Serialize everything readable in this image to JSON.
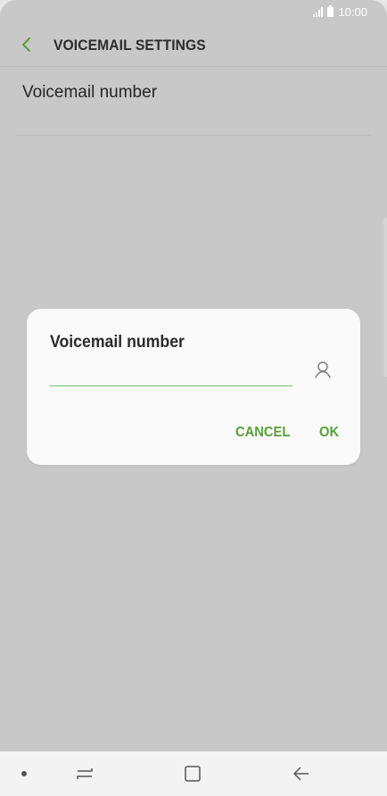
{
  "status_bar": {
    "time": "10:00"
  },
  "app_bar": {
    "title": "VOICEMAIL SETTINGS",
    "back_icon": "chevron-left-icon"
  },
  "settings": {
    "items": [
      {
        "label": "Voicemail number"
      }
    ]
  },
  "dialog": {
    "title": "Voicemail number",
    "input_value": "",
    "input_placeholder": "",
    "contact_icon": "contact-person-icon",
    "cancel_label": "CANCEL",
    "ok_label": "OK"
  },
  "nav_bar": {
    "icons": [
      "dot-icon",
      "recents-icon",
      "home-icon",
      "back-arrow-icon"
    ]
  },
  "colors": {
    "accent": "#5a9e3c",
    "input_underline": "#7cbf6e",
    "dim_background": "#c8c8c8",
    "dialog_background": "#fafafa"
  }
}
